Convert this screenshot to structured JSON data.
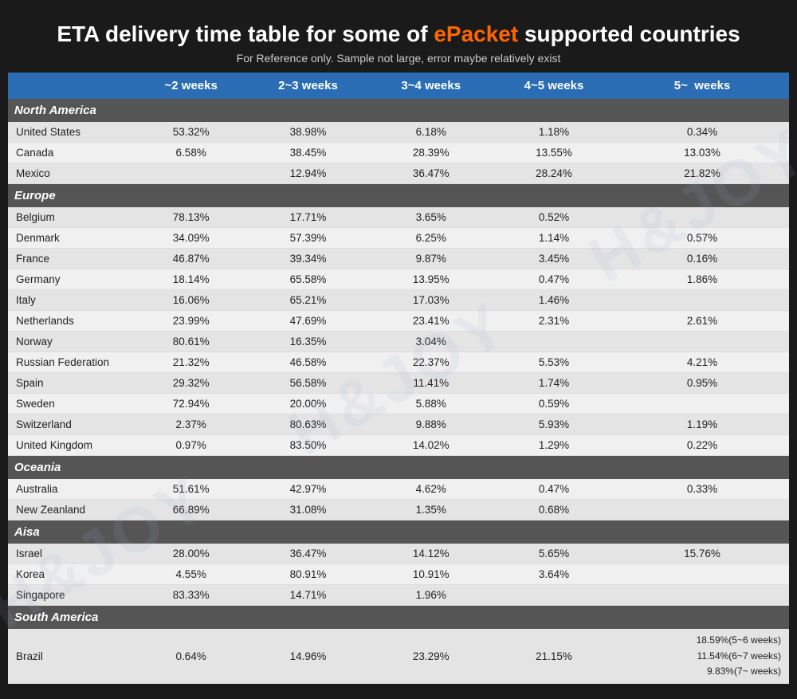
{
  "header": {
    "title_part1": "ETA delivery time table for some of ",
    "title_highlight": "ePacket",
    "title_part2": " supported countries",
    "subtitle": "For Reference only. Sample not large, error maybe relatively exist"
  },
  "table": {
    "columns": [
      "",
      "~2 weeks",
      "2~3 weeks",
      "3~4 weeks",
      "4~5 weeks",
      "5~  weeks"
    ],
    "sections": [
      {
        "name": "North America",
        "rows": [
          [
            "United States",
            "53.32%",
            "38.98%",
            "6.18%",
            "1.18%",
            "0.34%"
          ],
          [
            "Canada",
            "6.58%",
            "38.45%",
            "28.39%",
            "13.55%",
            "13.03%"
          ],
          [
            "Mexico",
            "",
            "12.94%",
            "36.47%",
            "28.24%",
            "21.82%"
          ]
        ]
      },
      {
        "name": "Europe",
        "rows": [
          [
            "Belgium",
            "78.13%",
            "17.71%",
            "3.65%",
            "0.52%",
            ""
          ],
          [
            "Denmark",
            "34.09%",
            "57.39%",
            "6.25%",
            "1.14%",
            "0.57%"
          ],
          [
            "France",
            "46.87%",
            "39.34%",
            "9.87%",
            "3.45%",
            "0.16%"
          ],
          [
            "Germany",
            "18.14%",
            "65.58%",
            "13.95%",
            "0.47%",
            "1.86%"
          ],
          [
            "Italy",
            "16.06%",
            "65.21%",
            "17.03%",
            "1.46%",
            ""
          ],
          [
            "Netherlands",
            "23.99%",
            "47.69%",
            "23.41%",
            "2.31%",
            "2.61%"
          ],
          [
            "Norway",
            "80.61%",
            "16.35%",
            "3.04%",
            "",
            ""
          ],
          [
            "Russian Federation",
            "21.32%",
            "46.58%",
            "22.37%",
            "5.53%",
            "4.21%"
          ],
          [
            "Spain",
            "29.32%",
            "56.58%",
            "11.41%",
            "1.74%",
            "0.95%"
          ],
          [
            "Sweden",
            "72.94%",
            "20.00%",
            "5.88%",
            "0.59%",
            ""
          ],
          [
            "Switzerland",
            "2.37%",
            "80.63%",
            "9.88%",
            "5.93%",
            "1.19%"
          ],
          [
            "United Kingdom",
            "0.97%",
            "83.50%",
            "14.02%",
            "1.29%",
            "0.22%"
          ]
        ]
      },
      {
        "name": "Oceania",
        "rows": [
          [
            "Australia",
            "51.61%",
            "42.97%",
            "4.62%",
            "0.47%",
            "0.33%"
          ],
          [
            "New Zeanland",
            "66.89%",
            "31.08%",
            "1.35%",
            "0.68%",
            ""
          ]
        ]
      },
      {
        "name": "Aisa",
        "rows": [
          [
            "Israel",
            "28.00%",
            "36.47%",
            "14.12%",
            "5.65%",
            "15.76%"
          ],
          [
            "Korea",
            "4.55%",
            "80.91%",
            "10.91%",
            "3.64%",
            ""
          ],
          [
            "Singapore",
            "83.33%",
            "14.71%",
            "1.96%",
            "",
            ""
          ]
        ]
      },
      {
        "name": "South America",
        "rows": [
          [
            "Brazil",
            "0.64%",
            "14.96%",
            "23.29%",
            "21.15%",
            "18.59%(5~6 weeks)\n11.54%(6~7 weeks)\n9.83%(7~ weeks)"
          ]
        ]
      }
    ]
  },
  "watermark": "H&JOY"
}
